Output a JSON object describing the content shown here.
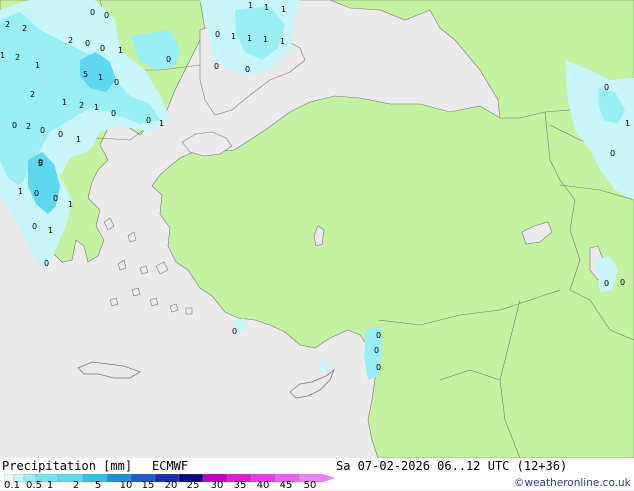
{
  "footer": {
    "title": "Precipitation [mm]",
    "model": "ECMWF",
    "datetime": "Sa 07-02-2026 06..12 UTC (12+36)",
    "credit": "©weatheronline.co.uk"
  },
  "legend": {
    "ticks": [
      "0.1",
      "0.5",
      "1",
      "2",
      "5",
      "10",
      "15",
      "20",
      "25",
      "30",
      "35",
      "40",
      "45",
      "50"
    ],
    "colors": [
      "#f5fbff",
      "#c8f6fa",
      "#9aeef5",
      "#74e4f2",
      "#5fd7ee",
      "#37bde8",
      "#1f8fd8",
      "#1a5fc4",
      "#1a2fa8",
      "#0a0a80",
      "#c000c0",
      "#d820d8",
      "#e040e8",
      "#ea60ef",
      "#f080f5"
    ]
  },
  "map": {
    "colors": {
      "sea": "#ebebeb",
      "land": "#c4f2a0",
      "rain_light": "#c8f6fa",
      "rain_mid": "#9aeef5",
      "rain_strong": "#5fd7ee",
      "border": "#777777"
    },
    "precip_labels": [
      "2",
      "0",
      "2",
      "0",
      "1",
      "1",
      "1",
      "1",
      "0",
      "1",
      "1",
      "1",
      "1",
      "2",
      "0",
      "0",
      "1",
      "0",
      "0",
      "0",
      "5",
      "1",
      "0",
      "2",
      "1",
      "2",
      "1",
      "0",
      "0",
      "1",
      "0",
      "2",
      "0",
      "0",
      "1",
      "0",
      "1",
      "0",
      "0",
      "1",
      "0",
      "5",
      "1",
      "0",
      "2",
      "1",
      "0",
      "1",
      "0",
      "0",
      "0",
      "0",
      "0",
      "0",
      "0"
    ]
  }
}
